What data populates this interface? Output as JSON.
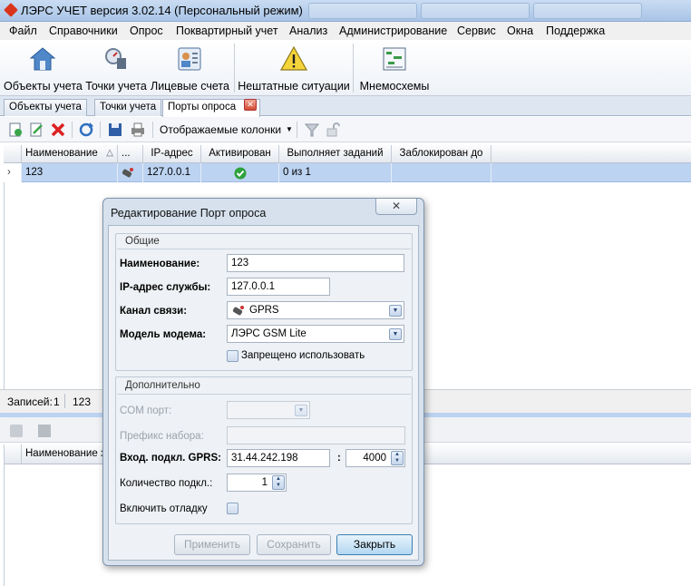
{
  "window": {
    "title": "ЛЭРС УЧЕТ версия 3.02.14 (Персональный режим)"
  },
  "menu": [
    "Файл",
    "Справочники",
    "Опрос",
    "Поквартирный учет",
    "Анализ",
    "Администрирование",
    "Сервис",
    "Окна",
    "Поддержка"
  ],
  "ribbon": {
    "objects": {
      "label": "Объекты учета",
      "icon": "house-icon"
    },
    "points": {
      "label": "Точки учета",
      "icon": "meter-icon"
    },
    "accounts": {
      "label": "Лицевые счета",
      "icon": "person-card-icon"
    },
    "emergencies": {
      "label": "Нештатные ситуации",
      "icon": "warning-icon"
    },
    "mnemo": {
      "label": "Мнемосхемы",
      "icon": "diagram-icon"
    }
  },
  "tabs": [
    "Объекты учета",
    "Точки учета",
    "Порты опроса"
  ],
  "toolbar": {
    "columns_label": "Отображаемые колонки"
  },
  "grid": {
    "columns": [
      "Наименование",
      "...",
      "IP-адрес",
      "Активирован",
      "Выполняет заданий",
      "Заблокирован до"
    ],
    "rows": [
      {
        "name": "123",
        "ip": "127.0.0.1",
        "activated": true,
        "tasks": "0 из 1",
        "blocked_until": ""
      }
    ]
  },
  "status": {
    "records_label": "Записей:",
    "records_count": "1",
    "current": "123"
  },
  "lower_grid": {
    "first_column": "Наименование за"
  },
  "dialog": {
    "title": "Редактирование Порт опроса",
    "general": {
      "title": "Общие",
      "name_label": "Наименование:",
      "name_value": "123",
      "ip_label": "IP-адрес службы:",
      "ip_value": "127.0.0.1",
      "channel_label": "Канал связи:",
      "channel_value": "GPRS",
      "modem_label": "Модель модема:",
      "modem_value": "ЛЭРС GSM Lite",
      "forbidden_label": "Запрещено использовать",
      "forbidden_checked": false
    },
    "extra": {
      "title": "Дополнительно",
      "com_label": "COM порт:",
      "com_value": "",
      "prefix_label": "Префикс набора:",
      "prefix_value": "",
      "gprs_label": "Вход. подкл. GPRS:",
      "gprs_ip": "31.44.242.198",
      "gprs_sep": ":",
      "gprs_port": "4000",
      "count_label": "Количество подкл.:",
      "count_value": "1",
      "debug_label": "Включить отладку",
      "debug_checked": false
    },
    "buttons": {
      "apply": "Применить",
      "save": "Сохранить",
      "close": "Закрыть"
    }
  },
  "colors": {
    "selection": "#bcd3f1",
    "dialog_bg": "#d6e1ed",
    "accent": "#3c7fb1"
  }
}
